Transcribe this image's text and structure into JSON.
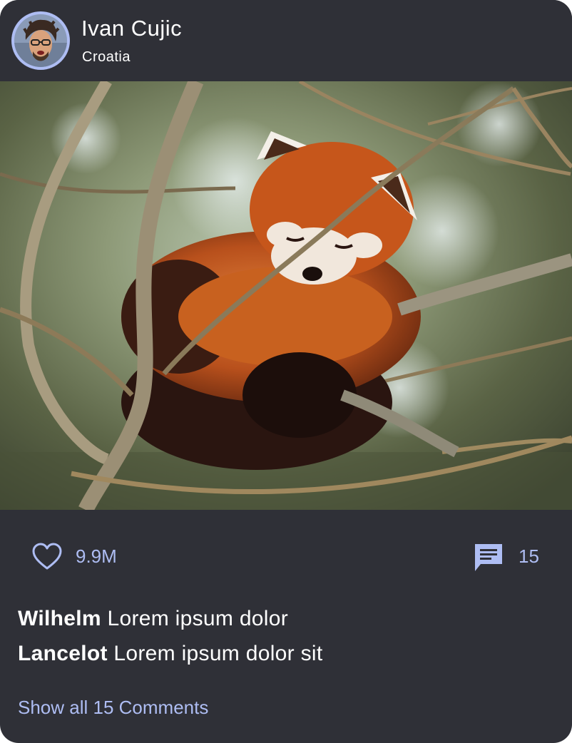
{
  "post": {
    "author": {
      "name": "Ivan Cujic",
      "location": "Croatia",
      "avatar_icon": "user-avatar"
    },
    "photo": {
      "subject_icon": "photo-red-panda"
    },
    "stats": {
      "likes": "9.9M",
      "comments": "15",
      "like_icon": "heart-outline-icon",
      "comment_icon": "chat-bubble-icon"
    },
    "comments": [
      {
        "user": "Wilhelm",
        "text": "Lorem ipsum dolor"
      },
      {
        "user": "Lancelot",
        "text": "Lorem ipsum dolor sit"
      }
    ],
    "show_all_label": "Show all 15 Comments"
  },
  "colors": {
    "card_bg": "#2f3037",
    "accent": "#aebdf3",
    "text": "#ffffff"
  }
}
